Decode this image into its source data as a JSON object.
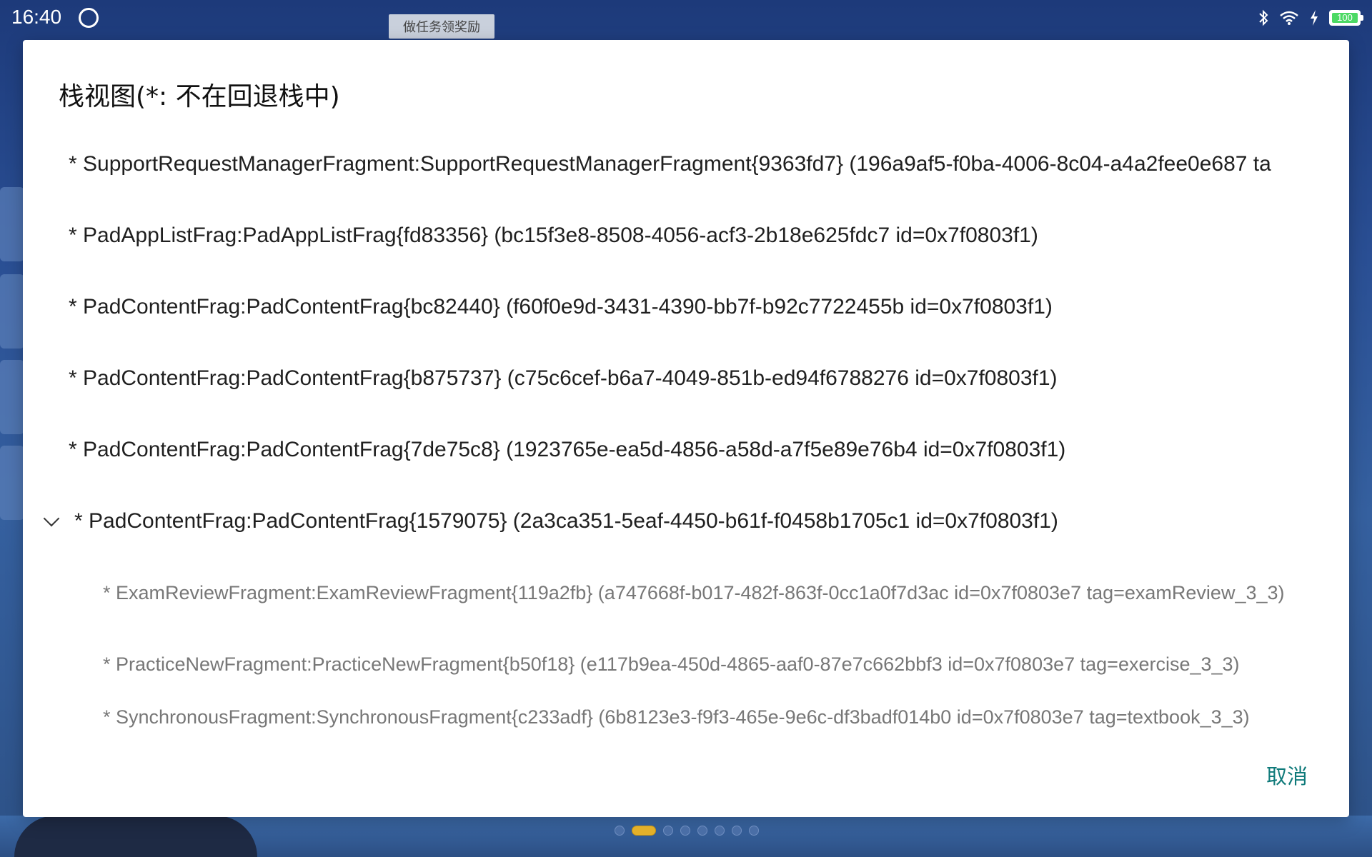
{
  "status_bar": {
    "time": "16:40",
    "app_icon": "app-circle-icon",
    "task_chip": "做任务领奖励",
    "icons": [
      "bluetooth-icon",
      "wifi-icon",
      "charging-icon"
    ],
    "battery": "100"
  },
  "dialog": {
    "title": "栈视图(*: 不在回退栈中)",
    "rows": [
      {
        "text": "* SupportRequestManagerFragment:SupportRequestManagerFragment{9363fd7} (196a9af5-f0ba-4006-8c04-a4a2fee0e687 ta",
        "level": 0
      },
      {
        "text": "* PadAppListFrag:PadAppListFrag{fd83356} (bc15f3e8-8508-4056-acf3-2b18e625fdc7 id=0x7f0803f1)",
        "level": 0
      },
      {
        "text": "* PadContentFrag:PadContentFrag{bc82440} (f60f0e9d-3431-4390-bb7f-b92c7722455b id=0x7f0803f1)",
        "level": 0
      },
      {
        "text": "* PadContentFrag:PadContentFrag{b875737} (c75c6cef-b6a7-4049-851b-ed94f6788276 id=0x7f0803f1)",
        "level": 0
      },
      {
        "text": "* PadContentFrag:PadContentFrag{7de75c8} (1923765e-ea5d-4856-a58d-a7f5e89e76b4 id=0x7f0803f1)",
        "level": 0
      },
      {
        "text": "* PadContentFrag:PadContentFrag{1579075} (2a3ca351-5eaf-4450-b61f-f0458b1705c1 id=0x7f0803f1)",
        "level": 0,
        "expanded": true
      },
      {
        "text": "* ExamReviewFragment:ExamReviewFragment{119a2fb} (a747668f-b017-482f-863f-0cc1a0f7d3ac id=0x7f0803e7 tag=examReview_3_3)",
        "level": 1
      },
      {
        "text": "* PracticeNewFragment:PracticeNewFragment{b50f18} (e117b9ea-450d-4865-aaf0-87e7c662bbf3 id=0x7f0803e7 tag=exercise_3_3)",
        "level": 1
      },
      {
        "text": "* SynchronousFragment:SynchronousFragment{c233adf} (6b8123e3-f9f3-465e-9e6c-df3badf014b0 id=0x7f0803e7 tag=textbook_3_3)",
        "level": 1
      }
    ],
    "cancel_label": "取消"
  },
  "pager": {
    "count": 8,
    "active_index": 1
  },
  "colors": {
    "accent": "#0f7a7a",
    "battery": "#4cd964",
    "active_dot": "#e3b02a"
  }
}
